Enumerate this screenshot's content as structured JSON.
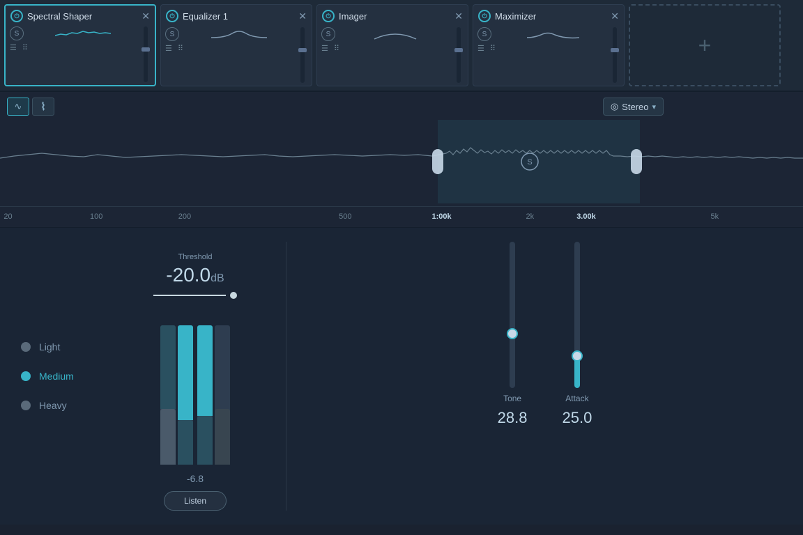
{
  "plugins": [
    {
      "id": "spectral-shaper",
      "name": "Spectral Shaper",
      "active": true,
      "power": true
    },
    {
      "id": "equalizer-1",
      "name": "Equalizer 1",
      "active": false,
      "power": true
    },
    {
      "id": "imager",
      "name": "Imager",
      "active": false,
      "power": true
    },
    {
      "id": "maximizer",
      "name": "Maximizer",
      "active": false,
      "power": true
    }
  ],
  "add_plugin_label": "+",
  "analyzer": {
    "stereo_label": "Stereo",
    "btn1_icon": "∿",
    "btn2_icon": "⌇"
  },
  "freq_labels": [
    {
      "label": "20",
      "pct": 1
    },
    {
      "label": "100",
      "pct": 12
    },
    {
      "label": "200",
      "pct": 23
    },
    {
      "label": "500",
      "pct": 43
    },
    {
      "label": "1:00k",
      "pct": 55,
      "bright": true
    },
    {
      "label": "2k",
      "pct": 67
    },
    {
      "label": "3.00k",
      "pct": 72,
      "bright": true
    },
    {
      "label": "5k",
      "pct": 89
    }
  ],
  "legend": [
    {
      "id": "light",
      "label": "Light",
      "color": "#5a6a7a",
      "active": false
    },
    {
      "id": "medium",
      "label": "Medium",
      "color": "#38b4c8",
      "active": true
    },
    {
      "id": "heavy",
      "label": "Heavy",
      "color": "#5a6a7a",
      "active": false
    }
  ],
  "threshold": {
    "label": "Threshold",
    "value": "-20.0",
    "unit": "dB"
  },
  "meter": {
    "value_label": "-6.8",
    "listen_label": "Listen"
  },
  "tone": {
    "label": "Tone",
    "value": "28.8"
  },
  "attack": {
    "label": "Attack",
    "value": "25.0"
  }
}
